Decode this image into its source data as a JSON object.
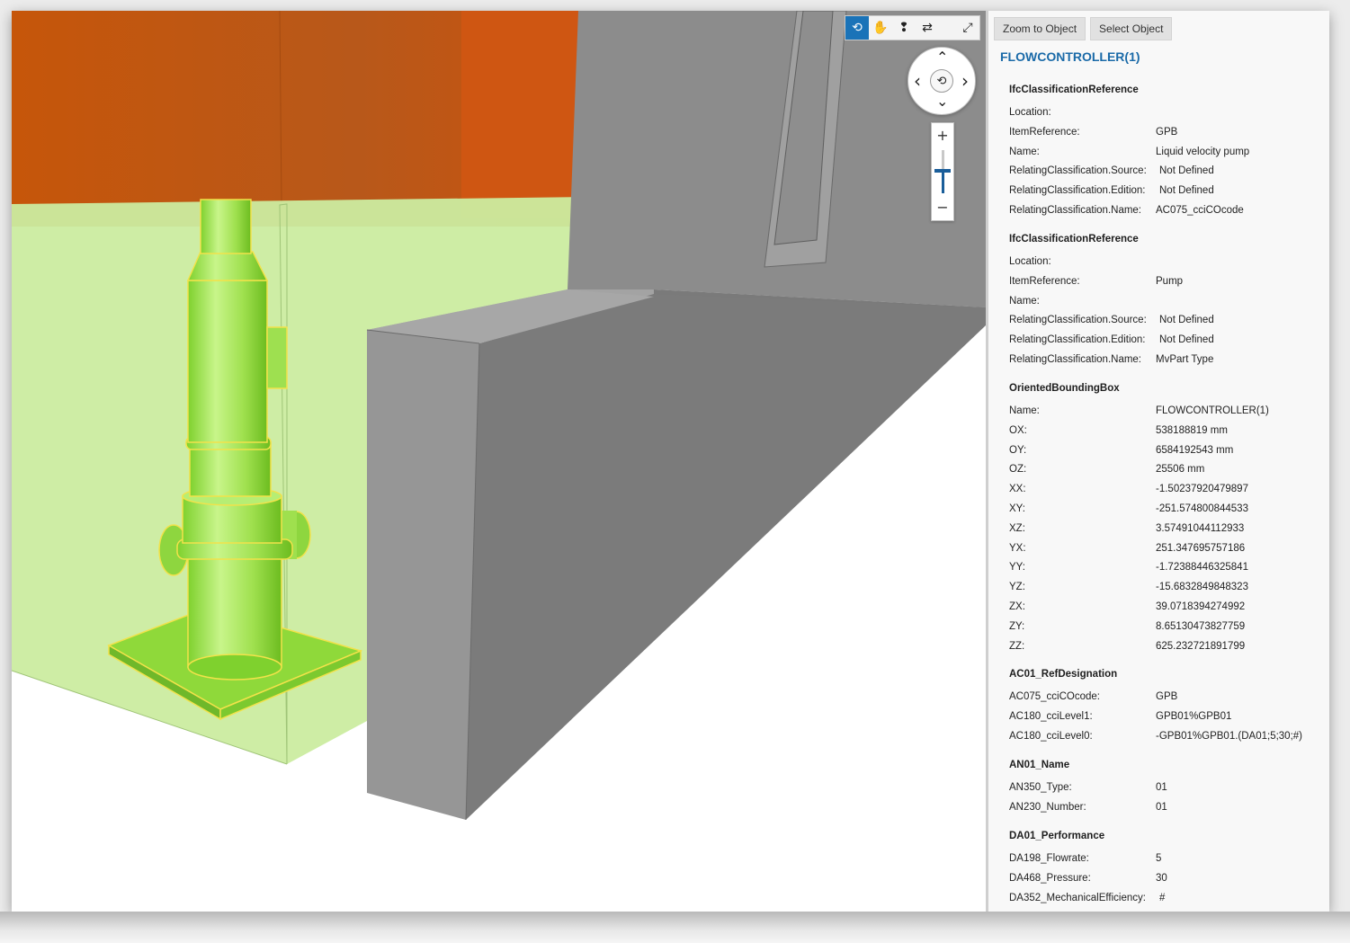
{
  "toolbar": {
    "tools": [
      {
        "name": "orbit",
        "icon": "orbit-icon",
        "glyph": "⟲",
        "active": true
      },
      {
        "name": "pan",
        "icon": "hand-icon",
        "glyph": "✋",
        "active": false
      },
      {
        "name": "walk",
        "icon": "footsteps-icon",
        "glyph": "❢",
        "active": false
      },
      {
        "name": "swap",
        "icon": "swap-arrows-icon",
        "glyph": "⇄",
        "active": false
      },
      {
        "name": "fullscreen",
        "icon": "expand-icon",
        "glyph": "⤢",
        "active": false
      }
    ]
  },
  "nav_wheel": {
    "up": "⌃",
    "down": "⌄",
    "left": "‹",
    "right": "›",
    "center": "⟲"
  },
  "zoom": {
    "plus": "+",
    "minus": "−",
    "level": 0.35
  },
  "panel": {
    "buttons": {
      "zoom_to_object": "Zoom to Object",
      "select_object": "Select Object"
    },
    "title": "FLOWCONTROLLER(1)",
    "groups": [
      {
        "heading": "IfcClassificationReference",
        "rows": [
          {
            "key": "Location:",
            "value": ""
          },
          {
            "key": "ItemReference:",
            "value": "GPB"
          },
          {
            "key": "Name:",
            "value": "Liquid velocity pump"
          },
          {
            "key": "RelatingClassification.Source:",
            "value": "Not Defined"
          },
          {
            "key": "RelatingClassification.Edition:",
            "value": "Not Defined"
          },
          {
            "key": "RelatingClassification.Name:",
            "value": "AC075_cciCOcode"
          }
        ]
      },
      {
        "heading": "IfcClassificationReference",
        "rows": [
          {
            "key": "Location:",
            "value": ""
          },
          {
            "key": "ItemReference:",
            "value": "Pump"
          },
          {
            "key": "Name:",
            "value": ""
          },
          {
            "key": "RelatingClassification.Source:",
            "value": "Not Defined"
          },
          {
            "key": "RelatingClassification.Edition:",
            "value": "Not Defined"
          },
          {
            "key": "RelatingClassification.Name:",
            "value": "MvPart Type"
          }
        ]
      },
      {
        "heading": "OrientedBoundingBox",
        "rows": [
          {
            "key": "Name:",
            "value": "FLOWCONTROLLER(1)"
          },
          {
            "key": "OX:",
            "value": "538188819 mm"
          },
          {
            "key": "OY:",
            "value": "6584192543 mm"
          },
          {
            "key": "OZ:",
            "value": "25506 mm"
          },
          {
            "key": "XX:",
            "value": "-1.50237920479897"
          },
          {
            "key": "XY:",
            "value": "-251.574800844533"
          },
          {
            "key": "XZ:",
            "value": "3.57491044112933"
          },
          {
            "key": "YX:",
            "value": "251.347695757186"
          },
          {
            "key": "YY:",
            "value": "-1.72388446325841"
          },
          {
            "key": "YZ:",
            "value": "-15.6832849848323"
          },
          {
            "key": "ZX:",
            "value": "39.0718394274992"
          },
          {
            "key": "ZY:",
            "value": "8.65130473827759"
          },
          {
            "key": "ZZ:",
            "value": "625.232721891799"
          }
        ]
      },
      {
        "heading": "AC01_RefDesignation",
        "rows": [
          {
            "key": "AC075_cciCOcode:",
            "value": "GPB"
          },
          {
            "key": "AC180_cciLevel1:",
            "value": "GPB01%GPB01"
          },
          {
            "key": "AC180_cciLevel0:",
            "value": "-GPB01%GPB01.(DA01;5;30;#)"
          }
        ]
      },
      {
        "heading": "AN01_Name",
        "rows": [
          {
            "key": "AN350_Type:",
            "value": "01"
          },
          {
            "key": "AN230_Number:",
            "value": "01"
          }
        ]
      },
      {
        "heading": "DA01_Performance",
        "rows": [
          {
            "key": "DA198_Flowrate:",
            "value": "5"
          },
          {
            "key": "DA468_Pressure:",
            "value": "30"
          },
          {
            "key": "DA352_MechanicalEfficiency:",
            "value": "#"
          }
        ]
      }
    ]
  },
  "colors": {
    "accent": "#1a73b8",
    "title": "#1a6aa8",
    "selection": "#a8ec5a",
    "selection_outline": "#f2e24a",
    "orange_wall": "#c25a12",
    "grey_wall": "#8a8a8a"
  }
}
